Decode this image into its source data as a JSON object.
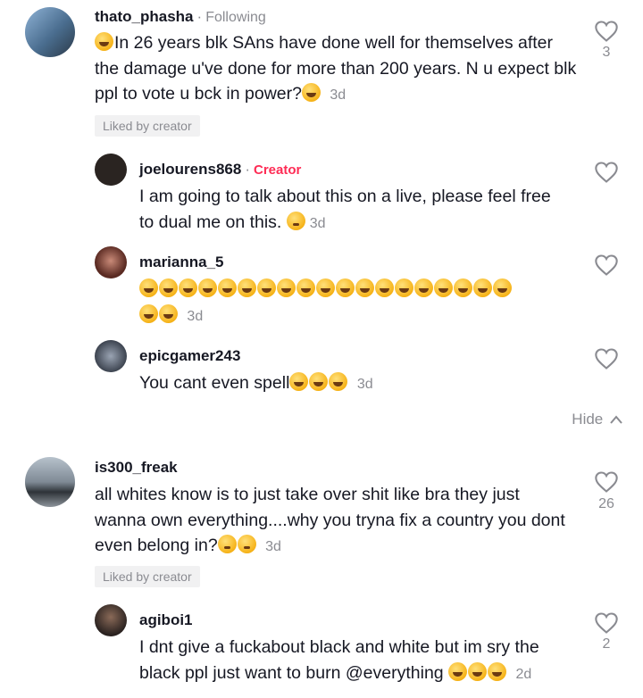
{
  "comments": [
    {
      "user": "thato_phasha",
      "badge": "Following",
      "text": "In 26 years blk SAns have done well for themselves after the damage u've done for more than 200 years. N u expect blk ppl to vote u bck in power?",
      "time": "3d",
      "liked_by_creator": "Liked by creator",
      "likes": "3"
    },
    {
      "user": "joelourens868",
      "badge": "Creator",
      "text": "I am going to talk about this on a live, please feel free to dual me on this.",
      "time": "3d"
    },
    {
      "user": "marianna_5",
      "time": "3d"
    },
    {
      "user": "epicgamer243",
      "text": "You cant even spell",
      "time": "3d"
    },
    {
      "user": "is300_freak",
      "text": "all whites know is to just take over shit like bra they just wanna own everything....why you tryna fix a country you dont even belong in?",
      "time": "3d",
      "liked_by_creator": "Liked by creator",
      "likes": "26"
    },
    {
      "user": "agiboi1",
      "text": "I dnt give a fuckabout black and white but im sry the black ppl just want to burn @everything",
      "time": "2d",
      "likes": "2"
    }
  ],
  "hide_label": "Hide",
  "icons": {
    "like": "heart-outline-icon",
    "hide": "chevron-up-icon",
    "emoji": "grinning-squinting-face-emoji"
  }
}
